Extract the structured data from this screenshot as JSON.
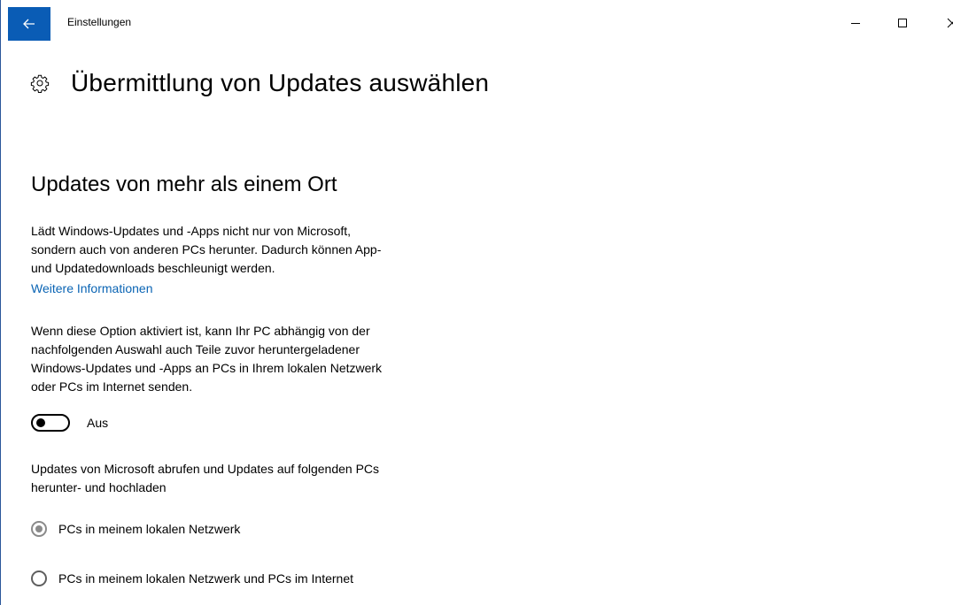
{
  "window": {
    "title": "Einstellungen",
    "accent_color": "#0a5cb5"
  },
  "header": {
    "title": "Übermittlung von Updates auswählen",
    "icon": "gear-icon"
  },
  "section": {
    "title": "Updates von mehr als einem Ort",
    "description_lines": [
      "Lädt Windows-Updates und -Apps nicht nur von Microsoft,",
      "sondern auch von anderen PCs herunter. Dadurch können App-",
      "und Updatedownloads beschleunigt werden."
    ],
    "link": "Weitere Informationen",
    "option_info_lines": [
      "Wenn diese Option aktiviert ist, kann Ihr PC abhängig von der",
      "nachfolgenden Auswahl auch Teile zuvor heruntergeladener",
      "Windows-Updates und -Apps an PCs in Ihrem lokalen Netzwerk",
      "oder PCs im Internet senden."
    ],
    "toggle": {
      "state": "off",
      "label": "Aus"
    },
    "radio_prompt_lines": [
      "Updates von Microsoft abrufen und Updates auf folgenden PCs",
      "herunter- und hochladen"
    ],
    "radio_options": [
      {
        "label": "PCs in meinem lokalen Netzwerk",
        "selected": true,
        "disabled": true
      },
      {
        "label": "PCs in meinem lokalen Netzwerk und PCs im Internet",
        "selected": false,
        "disabled": true
      }
    ]
  }
}
